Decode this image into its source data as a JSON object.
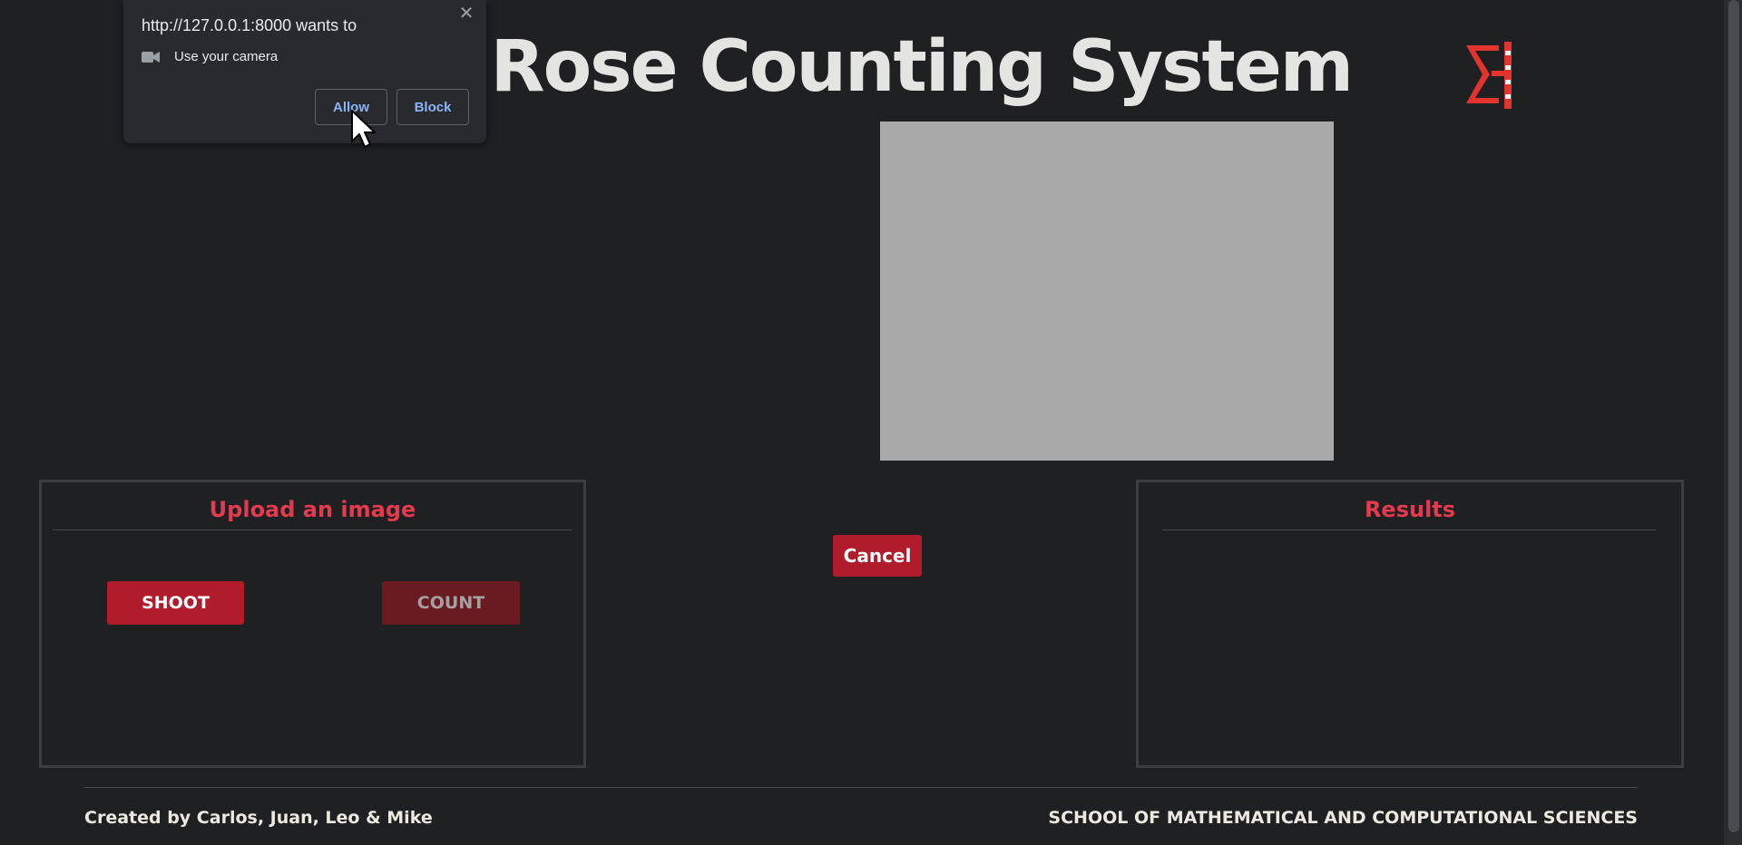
{
  "header": {
    "title": "AI Rose Counting System"
  },
  "upload_panel": {
    "title": "Upload an image",
    "shoot_label": "SHOOT",
    "count_label": "COUNT"
  },
  "cancel_label": "Cancel",
  "results_panel": {
    "title": "Results"
  },
  "footer": {
    "credits": "Created by Carlos, Juan, Leo & Mike",
    "school": "SCHOOL OF MATHEMATICAL AND COMPUTATIONAL SCIENCES"
  },
  "permission_popup": {
    "title": "http://127.0.0.1:8000 wants to",
    "request": "Use your camera",
    "allow_label": "Allow",
    "block_label": "Block",
    "close_glyph": "✕"
  },
  "colors": {
    "background": "#1f2022",
    "accent_red": "#e23a4e",
    "button_red": "#b01c2c",
    "button_disabled": "#6a1b22",
    "preview_gray": "#a9a9a9",
    "link_blue": "#8ab4f8"
  },
  "icons": {
    "logo": "sigma-logo-icon",
    "camera": "camera-icon",
    "close": "close-icon",
    "cursor": "mouse-cursor-icon"
  }
}
